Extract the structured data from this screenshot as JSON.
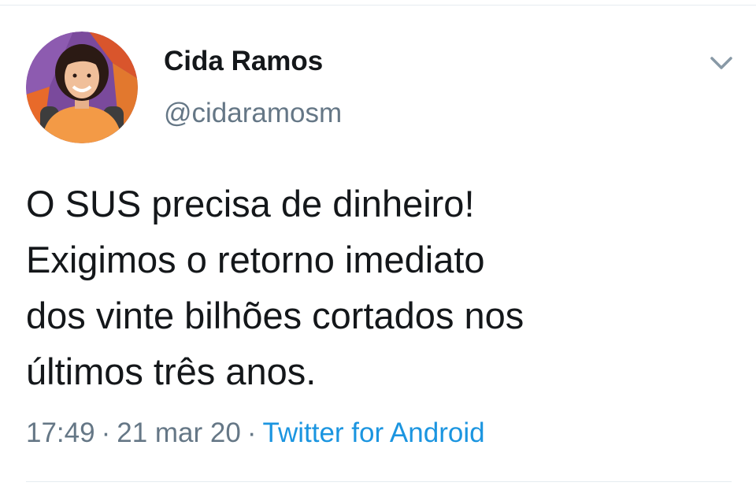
{
  "tweet": {
    "author": {
      "name": "Cida Ramos",
      "handle": "@cidaramosm",
      "avatar_icon": "profile-photo"
    },
    "menu_icon": "chevron-down-icon",
    "text": "O SUS precisa de dinheiro!\nExigimos o retorno imediato\ndos vinte bilhões cortados nos\núltimos três anos.",
    "time": "17:49",
    "separator": "·",
    "date": "21 mar 20",
    "source": "Twitter for Android"
  },
  "colors": {
    "text": "#14171a",
    "secondary": "#657786",
    "link": "#1b95e0",
    "divider": "#e6ecf0"
  }
}
